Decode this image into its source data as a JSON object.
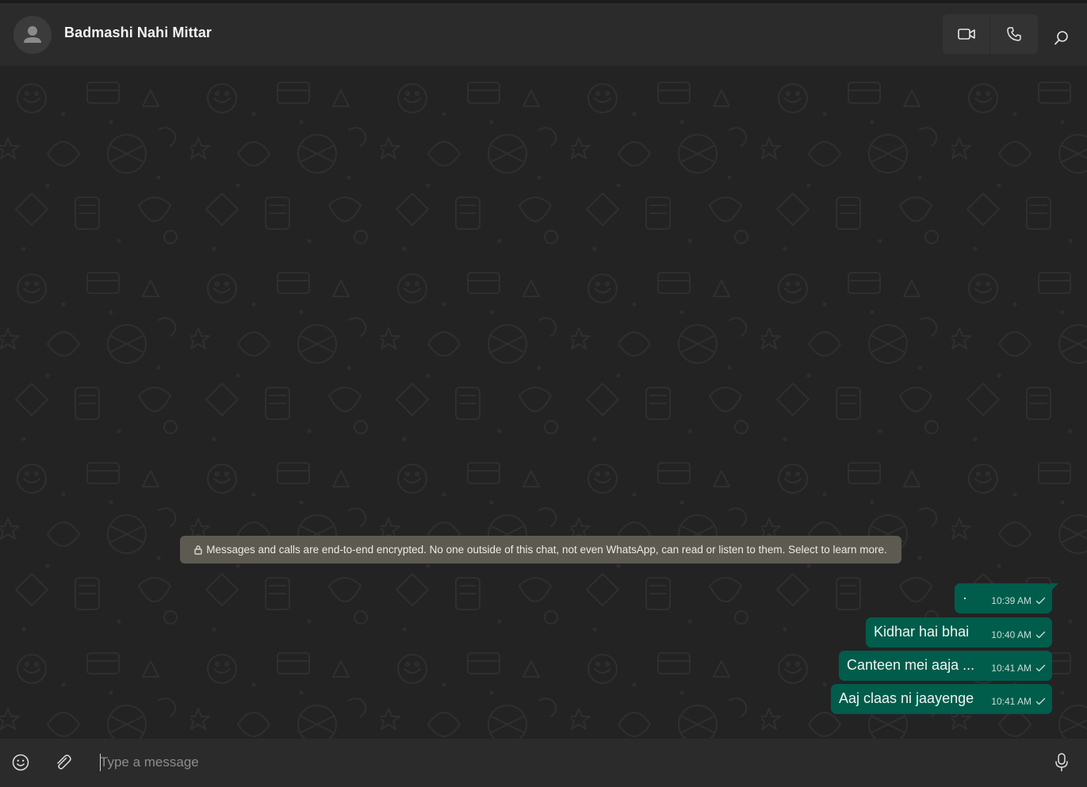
{
  "chat": {
    "contact_name": "Badmashi Nahi Mittar",
    "encryption_notice": "Messages and calls are end-to-end encrypted. No one outside of this chat, not even WhatsApp, can read or listen to them. Select to learn more.",
    "messages": [
      {
        "text": "·",
        "time": "10:39 AM",
        "status": "sent"
      },
      {
        "text": "Kidhar hai bhai",
        "time": "10:40 AM",
        "status": "sent"
      },
      {
        "text": "Canteen mei aaja ...",
        "time": "10:41 AM",
        "status": "sent"
      },
      {
        "text": "Aaj claas ni jaayenge",
        "time": "10:41 AM",
        "status": "sent"
      }
    ]
  },
  "header": {
    "icons": [
      "avatar-placeholder-icon",
      "video-call-icon",
      "voice-call-icon",
      "search-icon"
    ]
  },
  "composer": {
    "placeholder": "Type a message",
    "value": "",
    "icons": [
      "emoji-icon",
      "attach-icon",
      "microphone-icon"
    ]
  },
  "colors": {
    "header_bg": "#2b2b2b",
    "chat_bg": "#232323",
    "outgoing_bubble": "#005c4b",
    "notice_bg": "#5d5a51"
  }
}
